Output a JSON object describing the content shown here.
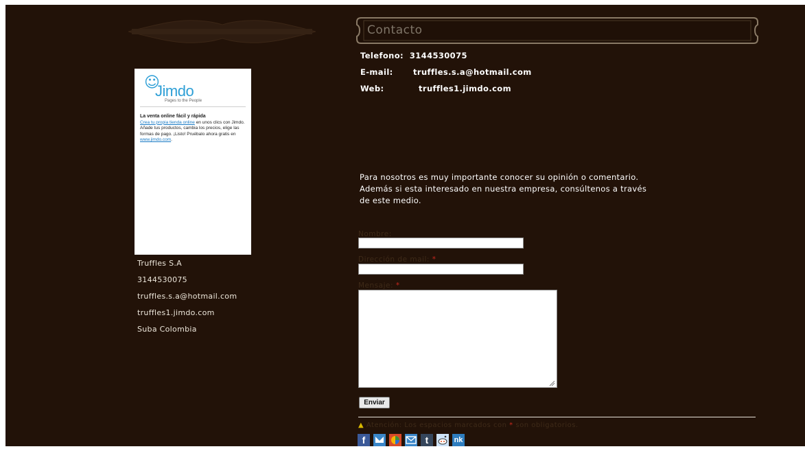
{
  "ad": {
    "logo_text": "Jimdo",
    "logo_tagline": "Pages to the People",
    "headline": "La venta online fácil y rápida",
    "link_text": "Crea tu propia tienda online",
    "body_text": "en unos clics con Jimdo. Añade tus productos, cambia los precios, elige las formas de pago. ¡Listo! Pruébalo ahora gratis en",
    "link_url_text": "www.jimdo.com",
    "end_punct": "."
  },
  "sidebar": {
    "company": "Truffles S.A",
    "phone": "3144530075",
    "email": "truffles.s.a@hotmail.com",
    "web": "truffles1.jimdo.com",
    "location": "Suba Colombia"
  },
  "section": {
    "title": "Contacto"
  },
  "contact": {
    "phone_label": "Telefono:",
    "phone_value": "3144530075",
    "email_label": "E-mail:",
    "email_value": "truffles.s.a@hotmail.com",
    "web_label": "Web:",
    "web_value": "truffles1.jimdo.com"
  },
  "intro": "Para nosotros es muy importante conocer su opinión o comentario. Además si esta interesado en nuestra empresa, consúltenos a través de este medio.",
  "form": {
    "name_label": "Nombre:",
    "email_label": "Dirección de mail:",
    "message_label": "Mensaje:",
    "required_mark": "*",
    "send_label": "Enviar",
    "note_warn_icon": "▲",
    "note_label": "Atención:",
    "note_text_before": "Los espacios marcados con",
    "note_text_after": "son obligatorios."
  },
  "share_icons": [
    "facebook-icon",
    "twitter-icon",
    "google-icon",
    "mail-icon",
    "tumblr-icon",
    "reddit-icon",
    "netlog-icon"
  ],
  "colors": {
    "background": "#221208",
    "accent_blue": "#2e9fd6",
    "required_red": "#c8281e",
    "warning_yellow": "#d8b800"
  }
}
